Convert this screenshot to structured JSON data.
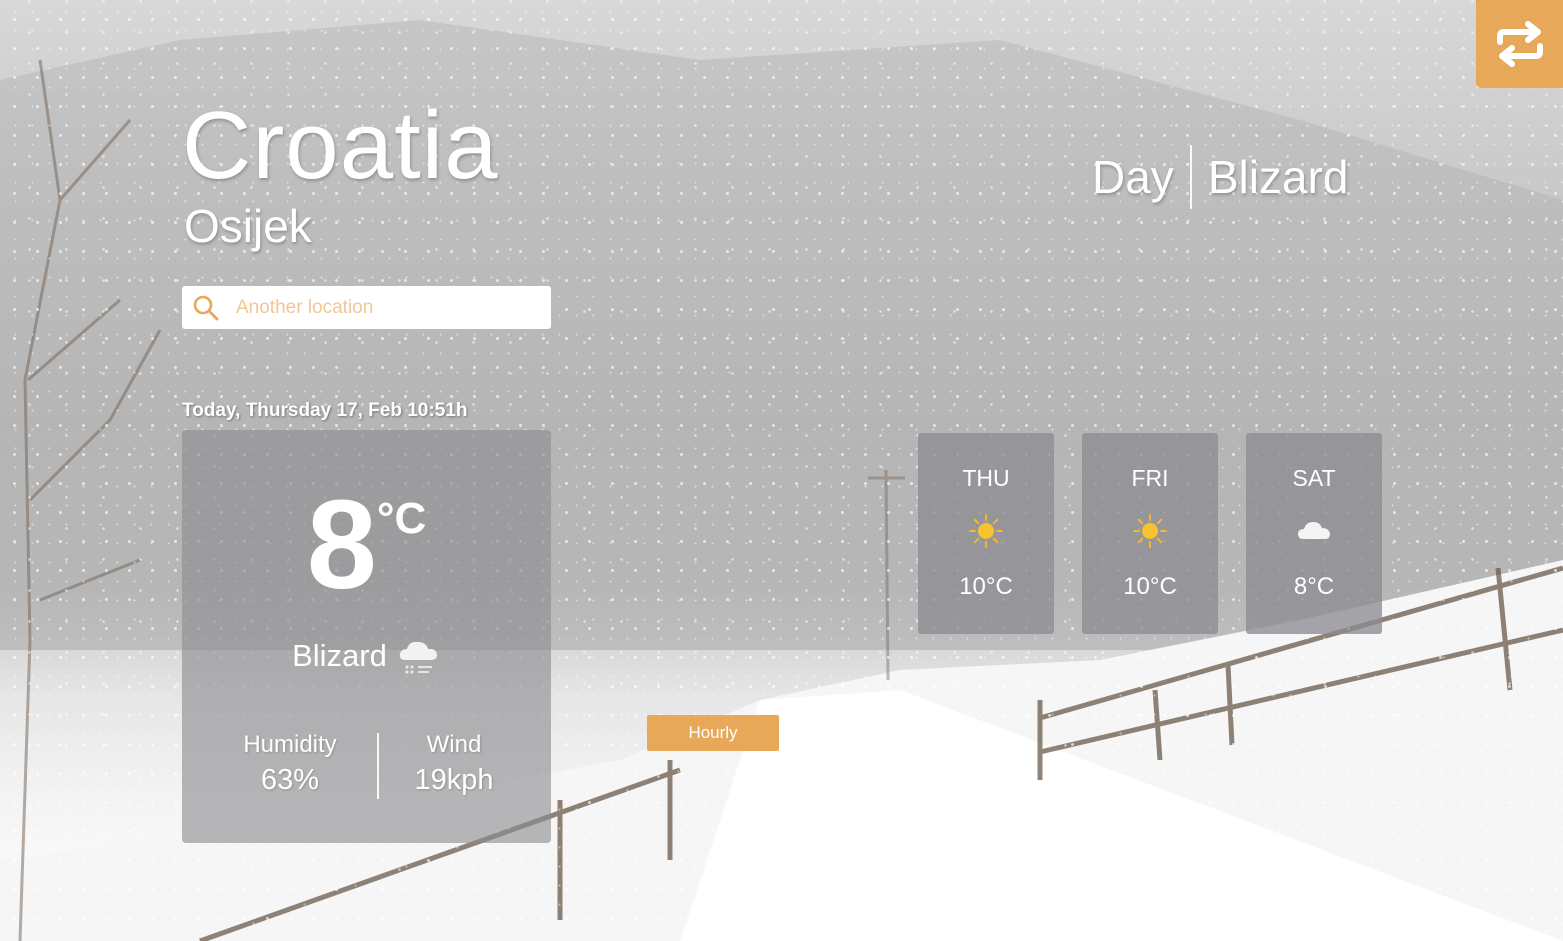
{
  "location": {
    "country": "Croatia",
    "city": "Osijek"
  },
  "search": {
    "placeholder": "Another location"
  },
  "header": {
    "daypart": "Day",
    "condition": "Blizard"
  },
  "current": {
    "date": "Today, Thursday 17, Feb 10:51h",
    "temperature": "8",
    "unit": "°C",
    "condition": "Blizard",
    "condition_icon": "snow-cloud-icon",
    "humidity_label": "Humidity",
    "humidity_value": "63%",
    "wind_label": "Wind",
    "wind_value": "19kph"
  },
  "forecast": [
    {
      "day": "THU",
      "icon": "sun-icon",
      "temp": "10°C"
    },
    {
      "day": "FRI",
      "icon": "sun-icon",
      "temp": "10°C"
    },
    {
      "day": "SAT",
      "icon": "cloud-icon",
      "temp": "8°C"
    }
  ],
  "buttons": {
    "hourly_label": "Hourly",
    "swap_icon": "swap-icon"
  },
  "colors": {
    "accent": "#e8a85a",
    "sun": "#f5b82e",
    "card": "#8c8c92"
  }
}
